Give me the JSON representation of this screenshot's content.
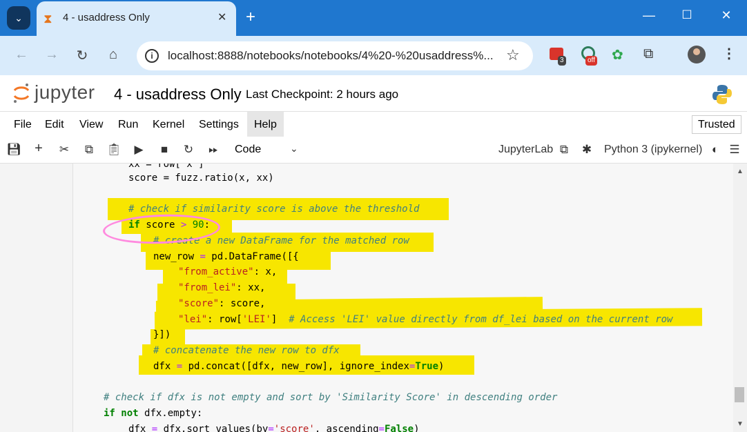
{
  "browser": {
    "tab_title": "4 - usaddress Only",
    "close_glyph": "✕",
    "new_tab_glyph": "+",
    "url": "localhost:8888/notebooks/notebooks/4%20-%20usaddress%...",
    "ext_badges": {
      "ext1": "3",
      "ext2": "off"
    }
  },
  "jupyter": {
    "logo_text": "jupyter",
    "notebook_name": "4 - usaddress Only",
    "checkpoint": "Last Checkpoint: 2 hours ago",
    "menu": [
      "File",
      "Edit",
      "View",
      "Run",
      "Kernel",
      "Settings",
      "Help"
    ],
    "trusted": "Trusted",
    "cell_type": "Code",
    "jupyterlab": "JupyterLab",
    "kernel": "Python 3 (ipykernel)"
  },
  "code": {
    "l0": "xx = row['x']",
    "l1a": "score = fuzz.",
    "l1b": "ratio",
    "l1c": "(x, xx)",
    "l2": "# check if similarity score is above the threshold",
    "l3a": "if",
    "l3b": " score ",
    "l3c": ">",
    "l3d": " ",
    "l3e": "90",
    "l3f": ":",
    "l4": "# create a new DataFrame for the matched row",
    "l5a": "new_row ",
    "l5b": "=",
    "l5c": " pd.",
    "l5d": "DataFrame",
    "l5e": "([{",
    "l6a": "\"from_active\"",
    "l6b": ": x,",
    "l7a": "\"from_lei\"",
    "l7b": ": xx,",
    "l8a": "\"score\"",
    "l8b": ": score,",
    "l9a": "\"lei\"",
    "l9b": ": row[",
    "l9c": "'LEI'",
    "l9d": "]  ",
    "l9e": "# Access 'LEI' value directly from df_lei based on the current row",
    "l10": "}])",
    "l11": "# concatenate the new row to dfx",
    "l12a": "dfx ",
    "l12b": "=",
    "l12c": " pd.",
    "l12d": "concat",
    "l12e": "([dfx, new_row], ignore_index",
    "l12f": "=",
    "l12g": "True",
    "l12h": ")",
    "l13": "# check if dfx is not empty and sort by 'Similarity Score' in descending order",
    "l14a": "if",
    "l14b": " ",
    "l14c": "not",
    "l14d": " dfx.",
    "l14e": "empty",
    "l14f": ":",
    "l15a": "dfx ",
    "l15b": "=",
    "l15c": " dfx.",
    "l15d": "sort_values",
    "l15e": "(by",
    "l15f": "=",
    "l15g": "'score'",
    "l15h": ", ascending",
    "l15i": "=",
    "l15j": "False",
    "l15k": ")"
  }
}
